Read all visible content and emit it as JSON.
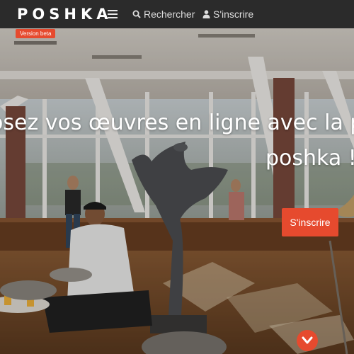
{
  "navbar": {
    "logo": "POSHKA",
    "search_label": "Rechercher",
    "signup_label": "S'inscrire"
  },
  "badge": {
    "label": "Version beta"
  },
  "hero": {
    "title_line1": "osez vos œuvres en ligne avec la p",
    "title_line2": "poshka !",
    "cta_label": "S'inscrire"
  },
  "colors": {
    "accent": "#e64a2e",
    "navbar": "#2b2b2b"
  },
  "icons": [
    "hamburger-menu-icon",
    "search-icon",
    "user-icon",
    "chevron-down-icon"
  ]
}
